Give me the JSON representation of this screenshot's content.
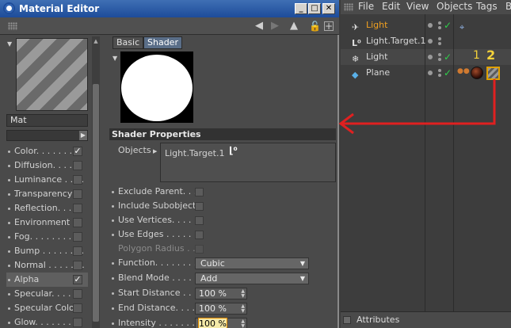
{
  "window": {
    "title": "Material Editor"
  },
  "window_buttons": {
    "minimize": "_",
    "maximize": "□",
    "close": "✕"
  },
  "material": {
    "name": "Mat"
  },
  "channels": [
    {
      "label": "Color. . . . . . . .",
      "checked": true
    },
    {
      "label": "Diffusion. . . . . .",
      "checked": false
    },
    {
      "label": "Luminance . . . . .",
      "checked": false
    },
    {
      "label": "Transparency",
      "checked": false
    },
    {
      "label": "Reflection. . . . .",
      "checked": false
    },
    {
      "label": "Environment",
      "checked": false
    },
    {
      "label": "Fog. . . . . . . . .",
      "checked": false
    },
    {
      "label": "Bump . . . . . . . .",
      "checked": false
    },
    {
      "label": "Normal . . . . . . .",
      "checked": false
    },
    {
      "label": "Alpha",
      "checked": true
    },
    {
      "label": "Specular. . . . . .",
      "checked": false
    },
    {
      "label": "Specular Color",
      "checked": false
    },
    {
      "label": "Glow. . . . . . . .",
      "checked": false
    }
  ],
  "tabs": {
    "basic": "Basic",
    "shader": "Shader"
  },
  "shader": {
    "heading": "Shader Properties",
    "objects_label": "Objects",
    "objects_value": "Light.Target.1",
    "exclude_parent": "Exclude Parent. . .",
    "include_subobjects": "Include Subobjects",
    "use_vertices": "Use Vertices. . . . .",
    "use_edges": "Use Edges . . . . . .",
    "polygon_radius": "Polygon Radius . .",
    "function_label": "Function. . . . . . . .",
    "function_value": "Cubic",
    "blend_label": "Blend Mode . . . . .",
    "blend_value": "Add",
    "start_label": "Start Distance . . .",
    "start_value": "100 %",
    "end_label": "End Distance. . . .",
    "end_value": "100 %",
    "intensity_label": "Intensity . . . . . . .",
    "intensity_value": "100 %"
  },
  "object_manager": {
    "menu": [
      "File",
      "Edit",
      "View",
      "Objects",
      "Tags",
      "B"
    ],
    "objects": [
      {
        "name": "Light",
        "highlight": "#f0a020"
      },
      {
        "name": "Light.Target.1"
      },
      {
        "name": "Light"
      },
      {
        "name": "Plane"
      }
    ],
    "attributes": "Attributes"
  },
  "annotations": {
    "one": "1",
    "two": "2",
    "arrow_color": "#e02020"
  }
}
